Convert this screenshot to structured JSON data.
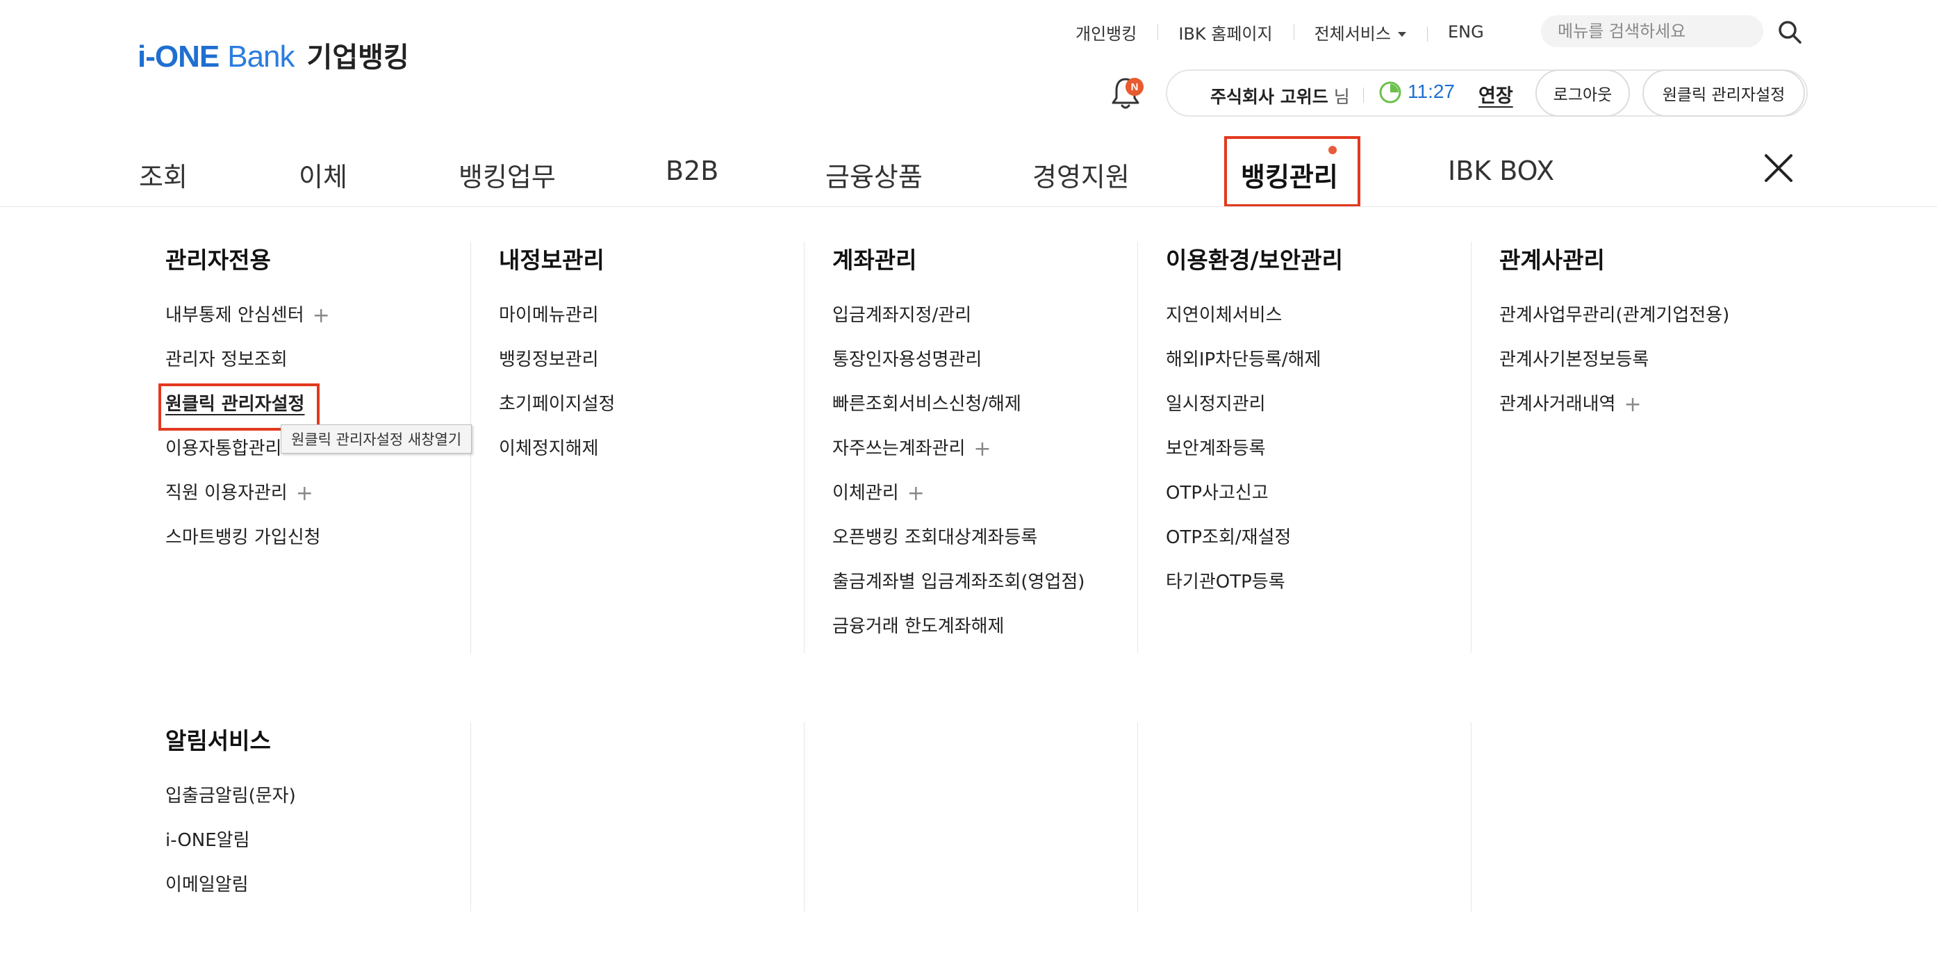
{
  "header": {
    "logo_brand_i": "i",
    "logo_brand_one": "-ONE",
    "logo_brand_bank": "Bank",
    "logo_corp": "기업뱅킹",
    "util_links": [
      "개인뱅킹",
      "IBK 홈페이지",
      "전체서비스",
      "ENG"
    ],
    "search_placeholder": "메뉴를 검색하세요",
    "notification_badge": "N",
    "user_name": "주식회사 고위드",
    "user_suffix": "님",
    "session_time": "11:27",
    "extend_label": "연장",
    "logout_label": "로그아웃",
    "oneclick_label": "원클릭 관리자설정"
  },
  "gnb": {
    "tabs": [
      "조회",
      "이체",
      "뱅킹업무",
      "B2B",
      "금융상품",
      "경영지원",
      "뱅킹관리",
      "IBK BOX"
    ],
    "active_tab": "뱅킹관리"
  },
  "menu": {
    "admin": {
      "title": "관리자전용",
      "items": [
        "내부통제 안심센터",
        "관리자 정보조회",
        "원클릭 관리자설정",
        "이용자통합관리",
        "직원 이용자관리",
        "스마트뱅킹 가입신청"
      ]
    },
    "internal": {
      "title": "내정보관리",
      "items": [
        "마이메뉴관리",
        "뱅킹정보관리",
        "초기페이지설정",
        "이체정지해제"
      ]
    },
    "account": {
      "title": "계좌관리",
      "items": [
        "입금계좌지정/관리",
        "통장인자용성명관리",
        "빠른조회서비스신청/해제",
        "자주쓰는계좌관리",
        "이체관리",
        "오픈뱅킹 조회대상계좌등록",
        "출금계좌별 입금계좌조회(영업점)",
        "금융거래 한도계좌해제"
      ]
    },
    "security": {
      "title": "이용환경/보안관리",
      "items": [
        "지연이체서비스",
        "해외IP차단등록/해제",
        "일시정지관리",
        "보안계좌등록",
        "OTP사고신고",
        "OTP조회/재설정",
        "타기관OTP등록"
      ]
    },
    "affiliate": {
      "title": "관계사관리",
      "items": [
        "관계사업무관리(관계기업전용)",
        "관계사기본정보등록",
        "관계사거래내역"
      ]
    },
    "alert": {
      "title": "알림서비스",
      "items": [
        "입출금알림(문자)",
        "i-ONE알림",
        "이메일알림"
      ]
    }
  },
  "tooltip": "원클릭 관리자설정 새창열기",
  "colors": {
    "brand_blue": "#1e6fd0",
    "highlight_red": "#e2391e",
    "badge_orange": "#e85a2f",
    "timer_green": "#6cc04a"
  }
}
